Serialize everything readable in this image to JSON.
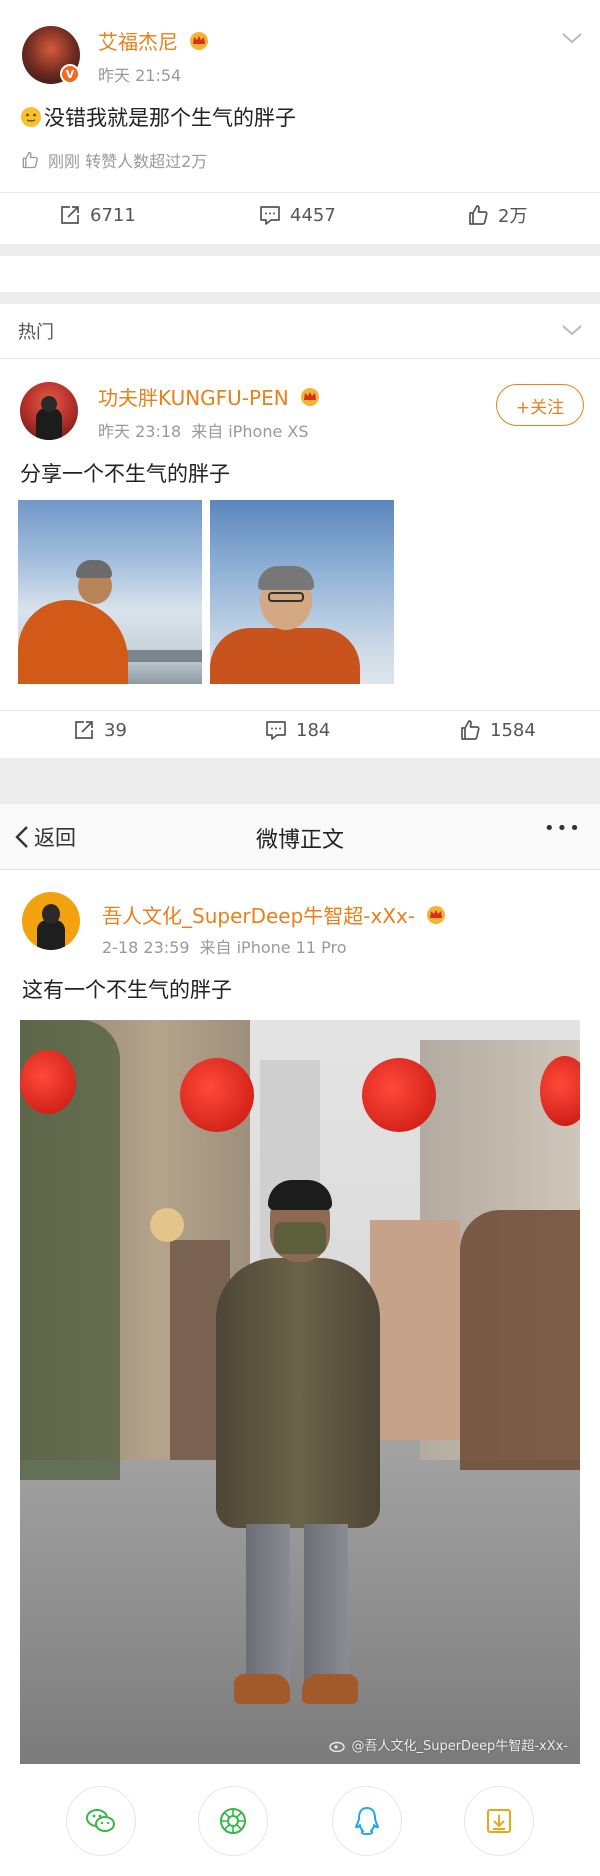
{
  "post1": {
    "username": "艾福杰尼",
    "time": "昨天 21:54",
    "content": "没错我就是那个生气的胖子",
    "like_note": "刚刚 转赞人数超过2万",
    "reposts": "6711",
    "comments": "4457",
    "likes": "2万"
  },
  "hot_section": {
    "label": "热门"
  },
  "post2": {
    "username": "功夫胖KUNGFU-PEN",
    "time": "昨天 23:18",
    "source": "来自 iPhone XS",
    "follow_label": "+关注",
    "content": "分享一个不生气的胖子",
    "reposts": "39",
    "comments": "184",
    "likes": "1584"
  },
  "detail_header": {
    "back_label": "返回",
    "title": "微博正文",
    "more": "•••"
  },
  "post3": {
    "username": "吾人文化_SuperDeep牛智超-xXx-",
    "time": "2-18 23:59",
    "source": "来自 iPhone 11 Pro",
    "content": "这有一个不生气的胖子",
    "watermark": "@吾人文化_SuperDeep牛智超-xXx-"
  },
  "share_targets": [
    "wechat-icon",
    "moments-icon",
    "qq-icon",
    "save-image-icon"
  ],
  "colors": {
    "accent_orange": "#e8801b",
    "separator": "#ededed",
    "share_green": "#3ab54a",
    "share_blue": "#1aa7f0",
    "share_gold": "#e6a817"
  }
}
